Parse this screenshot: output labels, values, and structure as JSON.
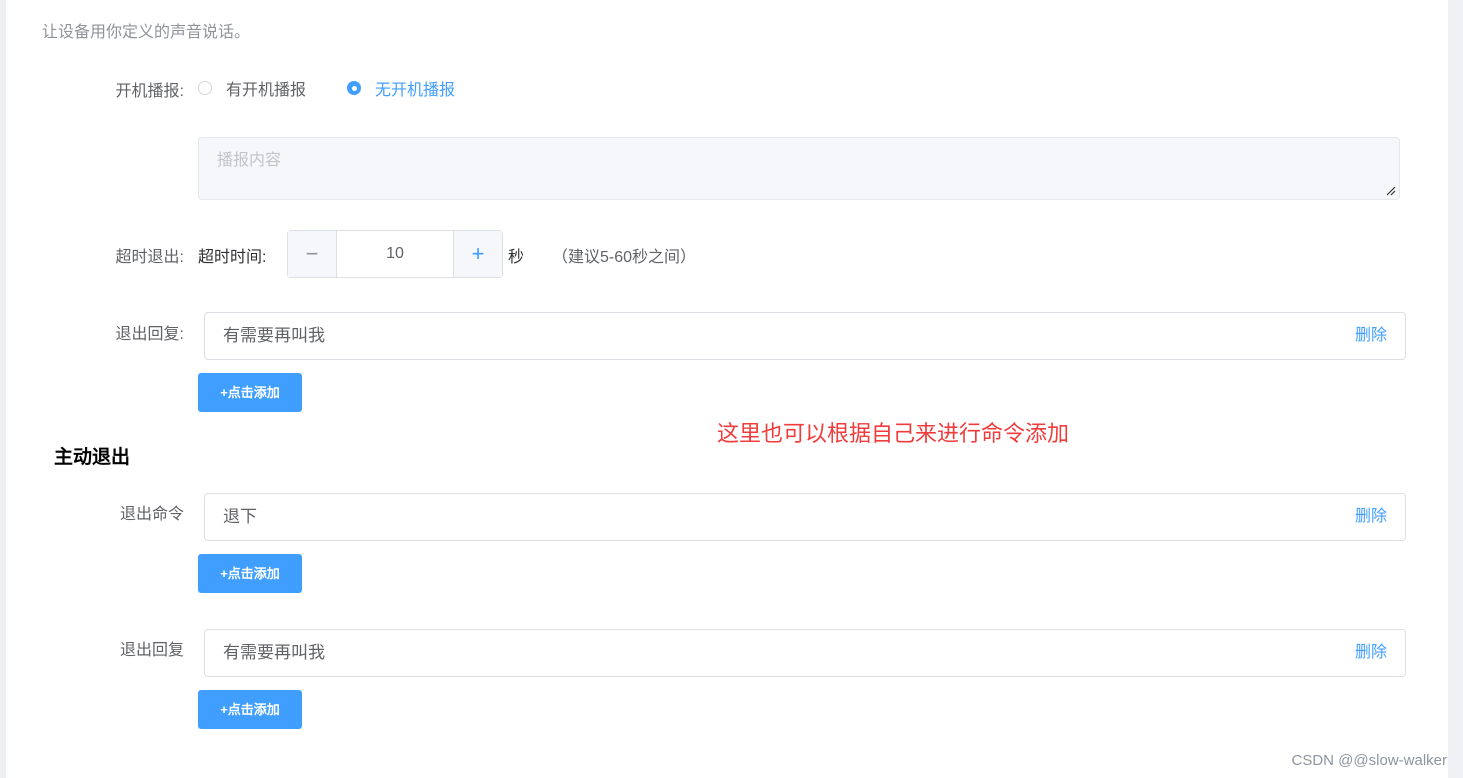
{
  "description": "让设备用你定义的声音说话。",
  "boot": {
    "label": "开机播报:",
    "options": [
      "有开机播报",
      "无开机播报"
    ],
    "selected": "无开机播报",
    "content_placeholder": "播报内容"
  },
  "timeout": {
    "label": "超时退出:",
    "sub_label": "超时时间:",
    "minus": "−",
    "plus": "+",
    "value": "10",
    "unit": "秒",
    "hint": "（建议5-60秒之间）"
  },
  "exit_reply": {
    "label": "退出回复:",
    "items": [
      {
        "text": "有需要再叫我",
        "delete": "删除"
      }
    ],
    "add_label": "+点击添加"
  },
  "annotation": "这里也可以根据自己来进行命令添加",
  "active_exit": {
    "title": "主动退出",
    "command": {
      "label": "退出命令",
      "items": [
        {
          "text": "退下",
          "delete": "删除"
        }
      ],
      "add_label": "+点击添加"
    },
    "reply": {
      "label": "退出回复",
      "items": [
        {
          "text": "有需要再叫我",
          "delete": "删除"
        }
      ],
      "add_label": "+点击添加"
    }
  },
  "watermark": "CSDN @@slow-walker",
  "colors": {
    "primary": "#409eff",
    "annotation": "#f03c3c",
    "background": "#eff0f4"
  }
}
